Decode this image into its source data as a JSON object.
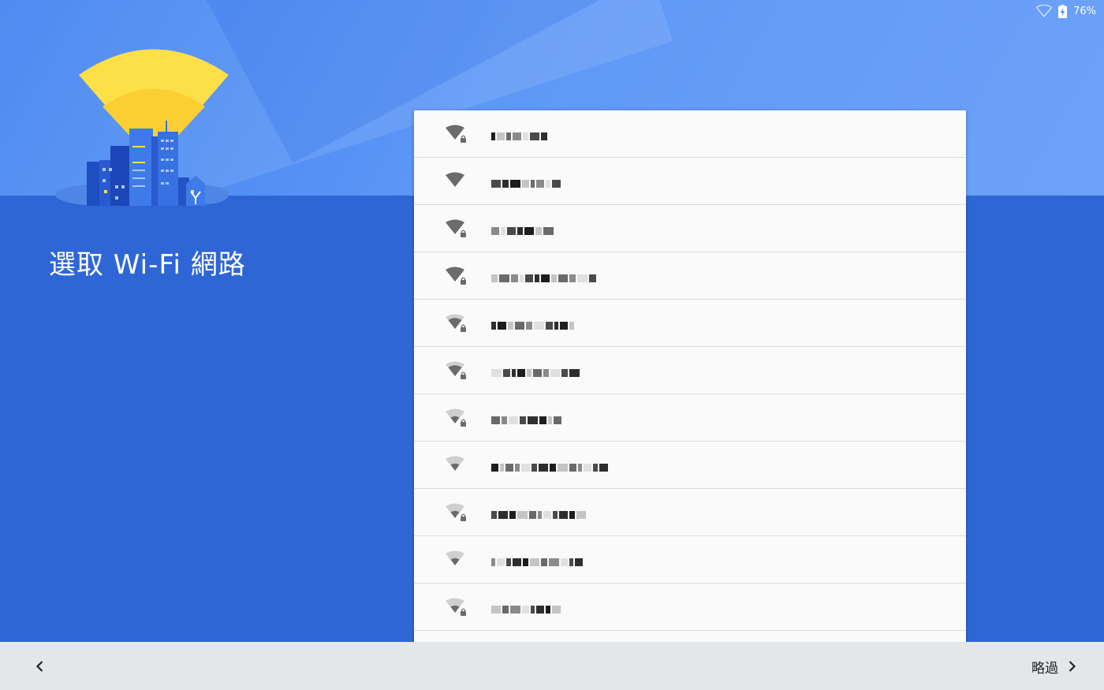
{
  "status_bar": {
    "battery": "76%",
    "wifi_icon": "wifi-outline-icon",
    "battery_icon": "battery-charging-icon"
  },
  "title": "選取 Wi-Fi 網路",
  "networks": [
    {
      "signal": 4,
      "locked": true
    },
    {
      "signal": 4,
      "locked": false
    },
    {
      "signal": 4,
      "locked": true
    },
    {
      "signal": 4,
      "locked": true
    },
    {
      "signal": 3,
      "locked": true
    },
    {
      "signal": 3,
      "locked": true
    },
    {
      "signal": 2,
      "locked": true
    },
    {
      "signal": 2,
      "locked": false
    },
    {
      "signal": 2,
      "locked": true
    },
    {
      "signal": 2,
      "locked": false
    },
    {
      "signal": 2,
      "locked": true
    }
  ],
  "footer": {
    "back_icon": "chevron-left-icon",
    "skip_label": "略過",
    "skip_icon": "chevron-right-icon"
  },
  "colors": {
    "top_band": "#5e98f6",
    "field": "#2f66d6",
    "card": "#fafafa",
    "footer": "#e4e7ea"
  }
}
